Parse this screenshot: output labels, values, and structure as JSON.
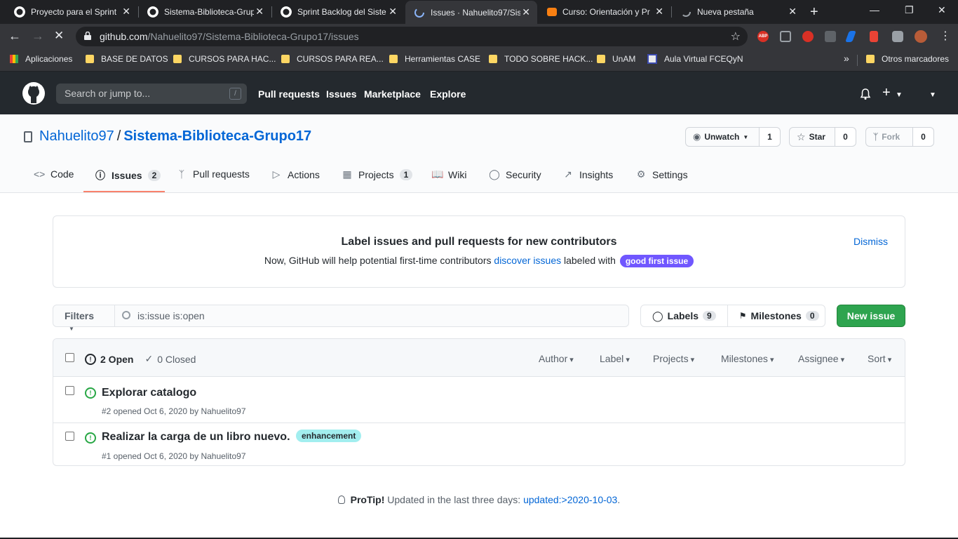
{
  "browser": {
    "tabs": [
      {
        "title": "Proyecto para el Sprint",
        "favicon": "github-icon"
      },
      {
        "title": "Sistema-Biblioteca-Grup",
        "favicon": "github-icon"
      },
      {
        "title": "Sprint Backlog del Siste",
        "favicon": "github-icon"
      },
      {
        "title": "Issues · Nahuelito97/Sis",
        "favicon": "github-icon",
        "active": true
      },
      {
        "title": "Curso: Orientación y Pr",
        "favicon": "moodle-icon"
      },
      {
        "title": "Nueva pestaña",
        "favicon": "loading-icon"
      }
    ],
    "url_host": "github.com",
    "url_path": "/Nahuelito97/Sistema-Biblioteca-Grupo17/issues",
    "bookmarks": [
      {
        "label": "Aplicaciones",
        "icon": "apps-grid-icon"
      },
      {
        "label": "BASE DE DATOS",
        "icon": "folder-icon"
      },
      {
        "label": "CURSOS PARA HAC...",
        "icon": "folder-icon"
      },
      {
        "label": "CURSOS PARA REA...",
        "icon": "folder-icon"
      },
      {
        "label": "Herramientas CASE",
        "icon": "folder-icon"
      },
      {
        "label": "TODO SOBRE HACK...",
        "icon": "folder-icon"
      },
      {
        "label": "UnAM",
        "icon": "folder-icon"
      },
      {
        "label": "Aula Virtual FCEQyN",
        "icon": "site-icon"
      }
    ],
    "bookmarks_overflow": "»",
    "other_bookmarks": "Otros marcadores",
    "extensions": [
      "ABP"
    ]
  },
  "github": {
    "search_placeholder": "Search or jump to...",
    "search_key": "/",
    "nav": [
      "Pull requests",
      "Issues",
      "Marketplace",
      "Explore"
    ]
  },
  "repo": {
    "owner": "Nahuelito97",
    "separator": "/",
    "name": "Sistema-Biblioteca-Grupo17",
    "unwatch_label": "Unwatch",
    "watch_count": "1",
    "star_label": "Star",
    "star_count": "0",
    "fork_label": "Fork",
    "fork_count": "0",
    "tabs": [
      {
        "label": "Code",
        "icon": "code-icon"
      },
      {
        "label": "Issues",
        "icon": "issue-opened-icon",
        "counter": "2",
        "selected": true
      },
      {
        "label": "Pull requests",
        "icon": "git-pull-request-icon"
      },
      {
        "label": "Actions",
        "icon": "play-icon"
      },
      {
        "label": "Projects",
        "icon": "project-icon",
        "counter": "1"
      },
      {
        "label": "Wiki",
        "icon": "book-icon"
      },
      {
        "label": "Security",
        "icon": "shield-icon"
      },
      {
        "label": "Insights",
        "icon": "graph-icon"
      },
      {
        "label": "Settings",
        "icon": "gear-icon"
      }
    ]
  },
  "banner": {
    "title": "Label issues and pull requests for new contributors",
    "text_before": "Now, GitHub will help potential first-time contributors",
    "link": "discover issues",
    "text_after": "labeled with",
    "label": "good first issue",
    "dismiss": "Dismiss"
  },
  "filters": {
    "filters_label": "Filters",
    "query": "is:issue is:open",
    "labels_label": "Labels",
    "labels_count": "9",
    "milestones_label": "Milestones",
    "milestones_count": "0",
    "new_issue": "New issue"
  },
  "issues": {
    "open_label": "2 Open",
    "closed_label": "0 Closed",
    "dropdowns": [
      "Author",
      "Label",
      "Projects",
      "Milestones",
      "Assignee",
      "Sort"
    ],
    "list": [
      {
        "title": "Explorar catalogo",
        "meta": "#2 opened Oct 6, 2020 by Nahuelito97",
        "labels": []
      },
      {
        "title": "Realizar la carga de un libro nuevo.",
        "meta": "#1 opened Oct 6, 2020 by Nahuelito97",
        "labels": [
          "enhancement"
        ]
      }
    ]
  },
  "protip": {
    "bold": "ProTip!",
    "text": "Updated in the last three days:",
    "link": "updated:>2020-10-03",
    "end": "."
  },
  "colors": {
    "header_bg": "#24292e",
    "link": "#0366d6",
    "green": "#2ea44f",
    "good_first_issue": "#7057ff",
    "enhancement": "#a2eeef",
    "selected_tab_underline": "#f9826c"
  }
}
